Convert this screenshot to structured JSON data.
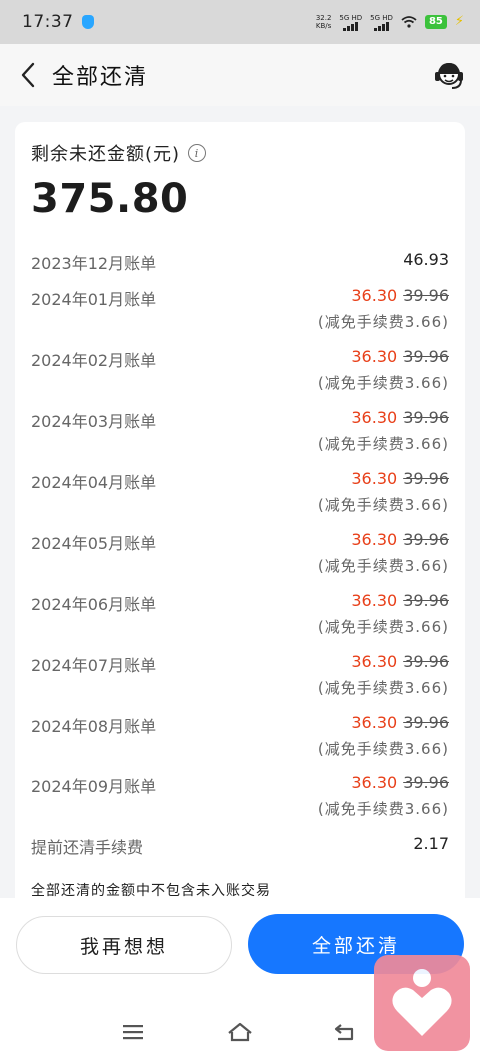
{
  "status_bar": {
    "time": "17:37",
    "net_speed_value": "32.2",
    "net_speed_unit": "KB/s",
    "sim1": "5G HD",
    "sim2": "5G HD",
    "battery": "85"
  },
  "header": {
    "title": "全部还清"
  },
  "summary": {
    "label": "剩余未还金额(元)",
    "amount": "375.80"
  },
  "bills": [
    {
      "month": "2023年12月账单",
      "amount": "46.93"
    },
    {
      "month": "2024年01月账单",
      "amount": "36.30",
      "original": "39.96",
      "waiver": "(减免手续费3.66)"
    },
    {
      "month": "2024年02月账单",
      "amount": "36.30",
      "original": "39.96",
      "waiver": "(减免手续费3.66)"
    },
    {
      "month": "2024年03月账单",
      "amount": "36.30",
      "original": "39.96",
      "waiver": "(减免手续费3.66)"
    },
    {
      "month": "2024年04月账单",
      "amount": "36.30",
      "original": "39.96",
      "waiver": "(减免手续费3.66)"
    },
    {
      "month": "2024年05月账单",
      "amount": "36.30",
      "original": "39.96",
      "waiver": "(减免手续费3.66)"
    },
    {
      "month": "2024年06月账单",
      "amount": "36.30",
      "original": "39.96",
      "waiver": "(减免手续费3.66)"
    },
    {
      "month": "2024年07月账单",
      "amount": "36.30",
      "original": "39.96",
      "waiver": "(减免手续费3.66)"
    },
    {
      "month": "2024年08月账单",
      "amount": "36.30",
      "original": "39.96",
      "waiver": "(减免手续费3.66)"
    },
    {
      "month": "2024年09月账单",
      "amount": "36.30",
      "original": "39.96",
      "waiver": "(减免手续费3.66)"
    }
  ],
  "fee": {
    "label": "提前还清手续费",
    "value": "2.17"
  },
  "note": "全部还清的金额中不包含未入账交易",
  "actions": {
    "secondary_label": "我再想想",
    "primary_label": "全部还清"
  },
  "colors": {
    "primary": "#1677ff",
    "discount_red": "#e8401a",
    "battery_green": "#3cc23c",
    "badge_pink": "#f08a9a"
  },
  "icons": {
    "back": "chevron-left-icon",
    "customer_service": "headset-icon",
    "info": "info-icon",
    "nav_menu": "menu-icon",
    "nav_home": "home-icon",
    "nav_back": "return-icon",
    "floating": "heart-person-icon"
  }
}
